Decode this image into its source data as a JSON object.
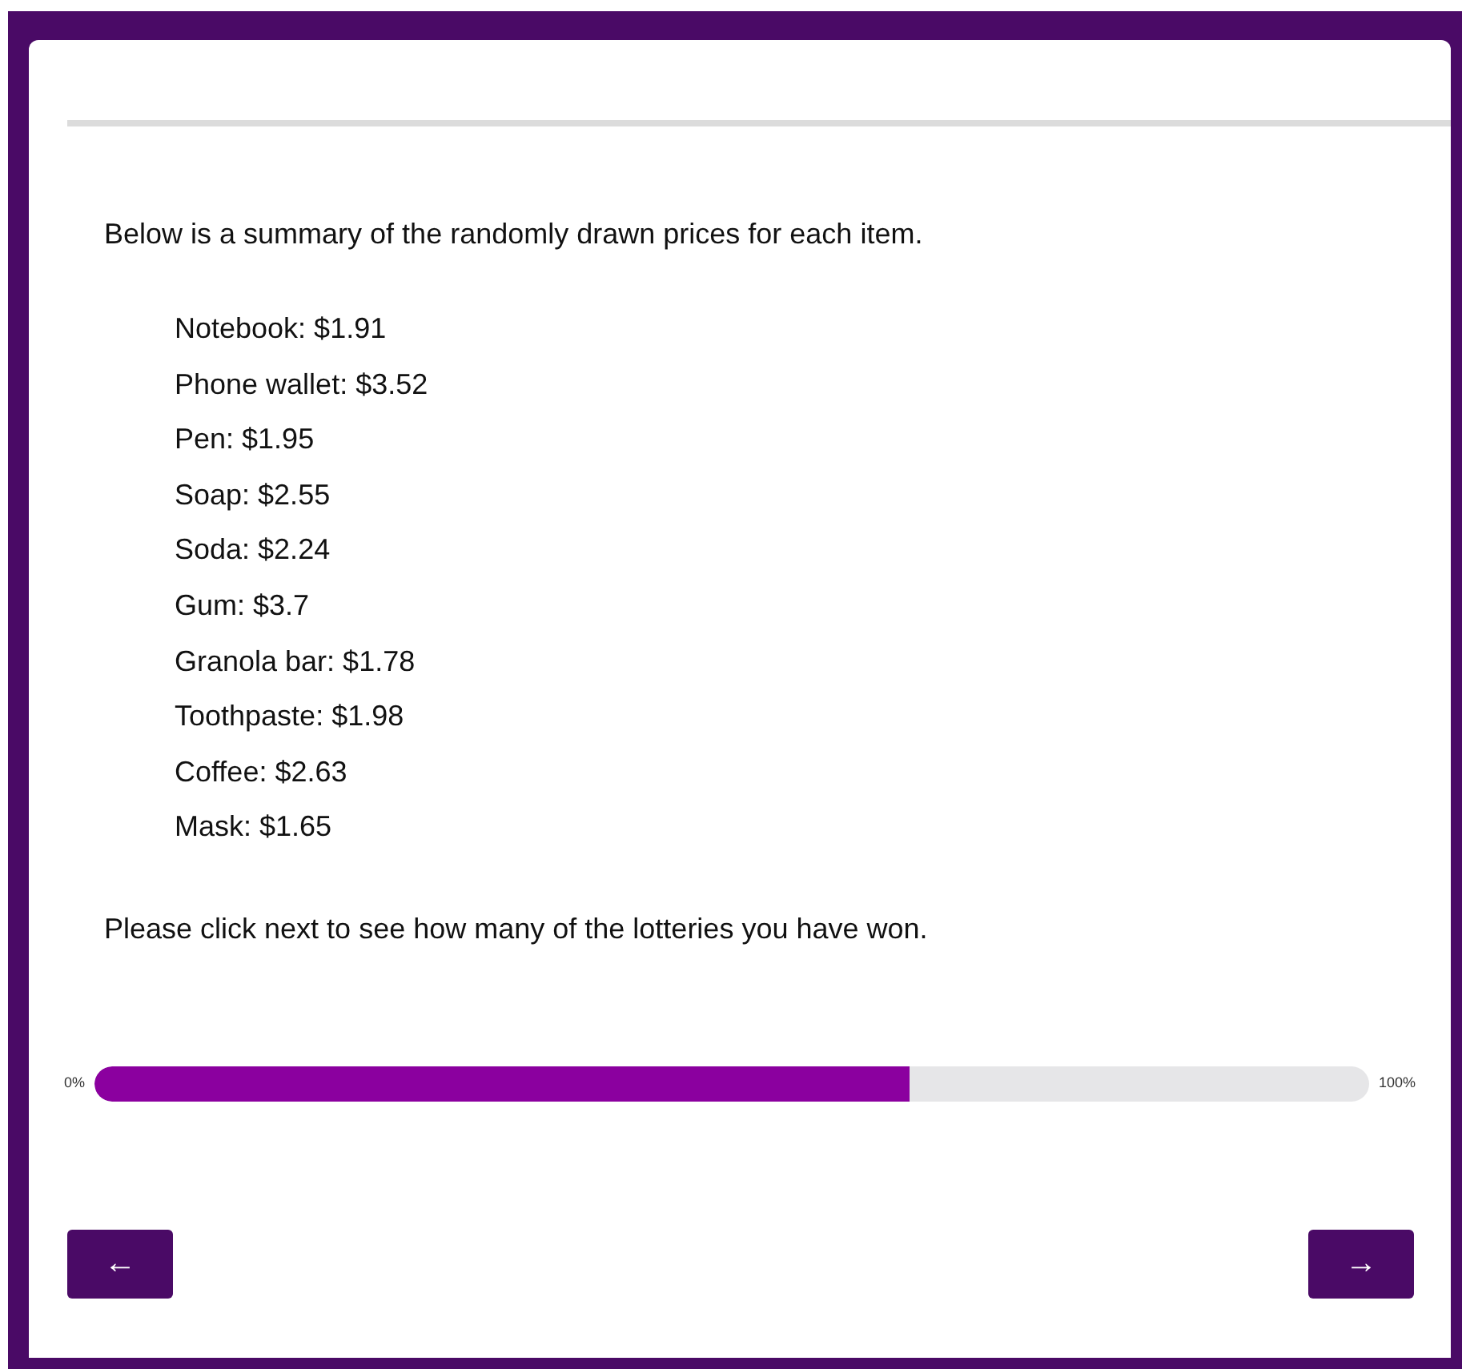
{
  "intro": "Below is a summary of the randomly drawn prices for each item.",
  "prices": [
    "Notebook: $1.91",
    "Phone wallet: $3.52",
    "Pen: $1.95",
    "Soap: $2.55",
    "Soda: $2.24",
    "Gum: $3.7",
    "Granola bar: $1.78",
    "Toothpaste: $1.98",
    "Coffee: $2.63",
    "Mask: $1.65"
  ],
  "instruction": "Please click next to see how many of the lotteries you have won.",
  "progress": {
    "min_label": "0%",
    "max_label": "100%",
    "level": 0.64
  },
  "buttons": {
    "back": "←",
    "next": "→"
  }
}
